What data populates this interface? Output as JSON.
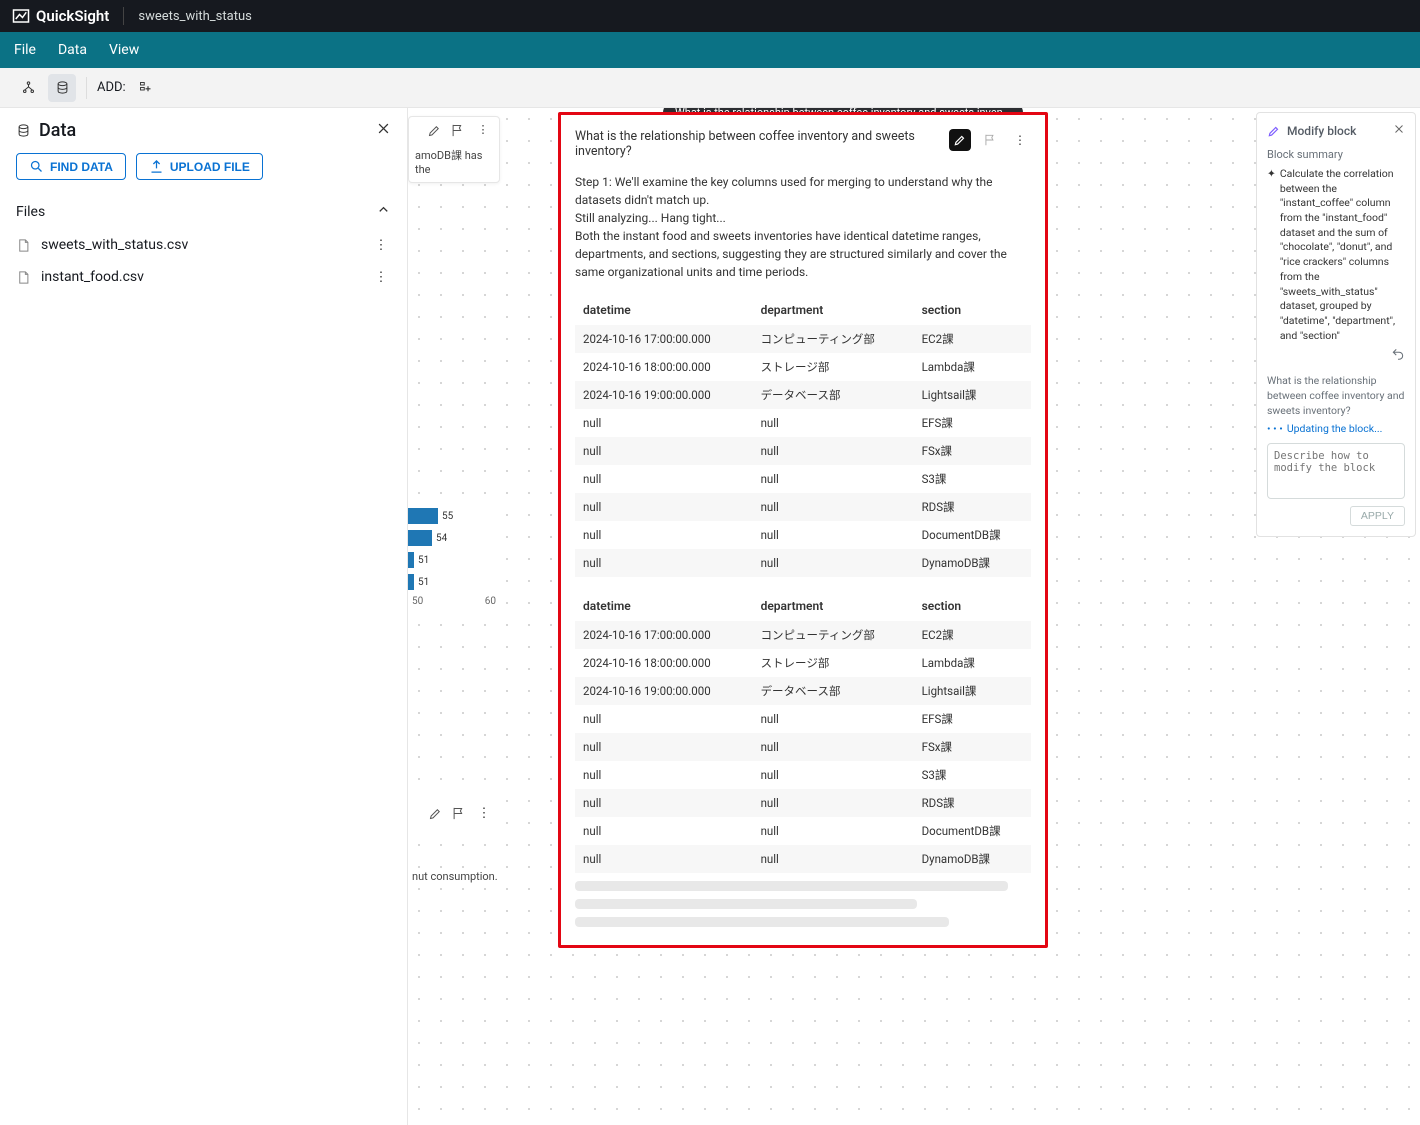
{
  "app": {
    "name": "QuickSight",
    "doc_title": "sweets_with_status"
  },
  "menubar": {
    "file": "File",
    "data": "Data",
    "view": "View"
  },
  "toolbar": {
    "add_label": "ADD:"
  },
  "data_panel": {
    "title": "Data",
    "find_data": "FIND DATA",
    "upload_file": "UPLOAD FILE",
    "files_header": "Files",
    "files": [
      {
        "name": "sweets_with_status.csv"
      },
      {
        "name": "instant_food.csv"
      }
    ]
  },
  "peek": {
    "text": "amoDB課 has the",
    "foot_text": "nut consumption.",
    "axis": {
      "left": "50",
      "right": "60"
    }
  },
  "tooltip": "What is the relationship between coffee inventory and sweets inven...",
  "analysis": {
    "title": "What is the relationship between coffee inventory and sweets inventory?",
    "step1": "Step 1: We'll examine the key columns used for merging to understand why the datasets didn't match up.",
    "hang": "Still analyzing... Hang tight...",
    "body": "Both the instant food and sweets inventories have identical datetime ranges, departments, and sections, suggesting they are structured similarly and cover the same organizational units and time periods.",
    "columns": {
      "datetime": "datetime",
      "department": "department",
      "section": "section"
    },
    "table1": [
      {
        "datetime": "2024-10-16 17:00:00.000",
        "department": "コンピューティング部",
        "section": "EC2課"
      },
      {
        "datetime": "2024-10-16 18:00:00.000",
        "department": "ストレージ部",
        "section": "Lambda課"
      },
      {
        "datetime": "2024-10-16 19:00:00.000",
        "department": "データベース部",
        "section": "Lightsail課"
      },
      {
        "datetime": "null",
        "department": "null",
        "section": "EFS課"
      },
      {
        "datetime": "null",
        "department": "null",
        "section": "FSx課"
      },
      {
        "datetime": "null",
        "department": "null",
        "section": "S3課"
      },
      {
        "datetime": "null",
        "department": "null",
        "section": "RDS課"
      },
      {
        "datetime": "null",
        "department": "null",
        "section": "DocumentDB課"
      },
      {
        "datetime": "null",
        "department": "null",
        "section": "DynamoDB課"
      }
    ],
    "table2": [
      {
        "datetime": "2024-10-16 17:00:00.000",
        "department": "コンピューティング部",
        "section": "EC2課"
      },
      {
        "datetime": "2024-10-16 18:00:00.000",
        "department": "ストレージ部",
        "section": "Lambda課"
      },
      {
        "datetime": "2024-10-16 19:00:00.000",
        "department": "データベース部",
        "section": "Lightsail課"
      },
      {
        "datetime": "null",
        "department": "null",
        "section": "EFS課"
      },
      {
        "datetime": "null",
        "department": "null",
        "section": "FSx課"
      },
      {
        "datetime": "null",
        "department": "null",
        "section": "S3課"
      },
      {
        "datetime": "null",
        "department": "null",
        "section": "RDS課"
      },
      {
        "datetime": "null",
        "department": "null",
        "section": "DocumentDB課"
      },
      {
        "datetime": "null",
        "department": "null",
        "section": "DynamoDB課"
      }
    ]
  },
  "modify": {
    "title": "Modify block",
    "summary_label": "Block summary",
    "summary_text": "Calculate the correlation between the \"instant_coffee\" column from the \"instant_food\" dataset and the sum of \"chocolate\", \"donut\", and \"rice crackers\" columns from the \"sweets_with_status\" dataset, grouped by \"datetime\", \"department\", and \"section\"",
    "question": "What is the relationship between coffee inventory and sweets inventory?",
    "status": "Updating the block...",
    "placeholder": "Describe how to modify the block",
    "apply": "APPLY"
  },
  "chart_data": {
    "type": "bar",
    "orientation": "horizontal",
    "categories": [
      "",
      "",
      "",
      ""
    ],
    "values": [
      55,
      54,
      51,
      51
    ],
    "xlim": [
      50,
      60
    ]
  }
}
